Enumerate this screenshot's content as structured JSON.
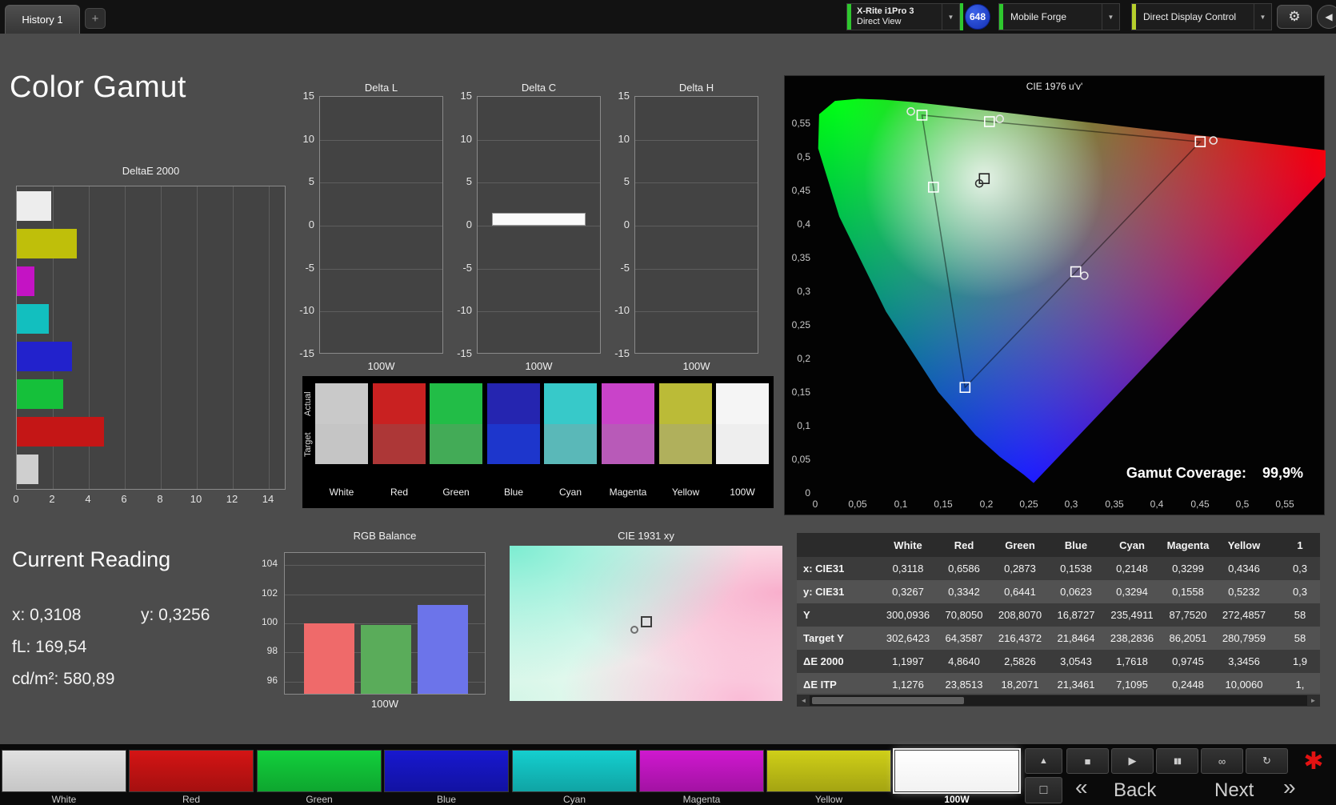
{
  "colors": {
    "meter_accent": "#2ec82e",
    "source_accent": "#2ec82e",
    "display_accent": "#b7cf2c",
    "separator_accent": "#2ec82e"
  },
  "icons": {
    "dropdown": "▼",
    "settings": "⚙",
    "collapse": "◀",
    "scroll_left": "◄",
    "scroll_right": "►",
    "expand": "▲",
    "frame": "□",
    "alert": "✱"
  },
  "top_bar": {
    "history_tab": "History 1",
    "add_tab": "+",
    "meter": {
      "name": "X-Rite i1Pro 3",
      "mode": "Direct View"
    },
    "badge_count": "648",
    "source_device": "Mobile Forge",
    "display_control": "Direct Display Control"
  },
  "page_title": "Color Gamut",
  "deltae_chart": {
    "type": "bar",
    "title": "DeltaE 2000",
    "x_ticks": [
      0,
      2,
      4,
      6,
      8,
      10,
      12,
      14
    ],
    "x_max": 14,
    "bars": [
      {
        "name": "100W",
        "value": 1.9,
        "color": "#ededed"
      },
      {
        "name": "Yellow",
        "value": 3.35,
        "color": "#bfbf0a"
      },
      {
        "name": "Magenta",
        "value": 0.97,
        "color": "#c413c4"
      },
      {
        "name": "Cyan",
        "value": 1.76,
        "color": "#12bfbf"
      },
      {
        "name": "Blue",
        "value": 3.05,
        "color": "#2222cc"
      },
      {
        "name": "Green",
        "value": 2.58,
        "color": "#15c03a"
      },
      {
        "name": "Red",
        "value": 4.86,
        "color": "#c41616"
      },
      {
        "name": "White",
        "value": 1.2,
        "color": "#cfcfcf"
      }
    ]
  },
  "delta_charts": {
    "type": "bar",
    "y_ticks": [
      15,
      10,
      5,
      0,
      -5,
      -10,
      -15
    ],
    "y_max": 15,
    "x_label": "100W",
    "charts": [
      {
        "title": "Delta L",
        "value": 0
      },
      {
        "title": "Delta C",
        "value": 1.5
      },
      {
        "title": "Delta H",
        "value": 0
      }
    ]
  },
  "swatch_compare": {
    "row_labels": [
      "Actual",
      "Target"
    ],
    "columns": [
      {
        "label": "White",
        "actual": "#c9c9c9",
        "target": "#c5c5c5"
      },
      {
        "label": "Red",
        "actual": "#c92121",
        "target": "#ad3737"
      },
      {
        "label": "Green",
        "actual": "#22bd47",
        "target": "#43ab57"
      },
      {
        "label": "Blue",
        "actual": "#2525b0",
        "target": "#1d36cc"
      },
      {
        "label": "Cyan",
        "actual": "#37c9c9",
        "target": "#5ab8b8"
      },
      {
        "label": "Magenta",
        "actual": "#c943c9",
        "target": "#b85ab8"
      },
      {
        "label": "Yellow",
        "actual": "#bbbb37",
        "target": "#b0b05c"
      },
      {
        "label": "100W",
        "actual": "#f5f5f5",
        "target": "#eeeeee"
      }
    ]
  },
  "cie1976": {
    "title": "CIE 1976 u'v'",
    "x_ticks": [
      "0",
      "0,05",
      "0,1",
      "0,15",
      "0,2",
      "0,25",
      "0,3",
      "0,35",
      "0,4",
      "0,45",
      "0,5",
      "0,55"
    ],
    "y_ticks": [
      "0",
      "0,05",
      "0,1",
      "0,15",
      "0,2",
      "0,25",
      "0,3",
      "0,35",
      "0,4",
      "0,45",
      "0,5",
      "0,55"
    ],
    "gamut_coverage_label": "Gamut Coverage:",
    "gamut_coverage_value": "99,9%",
    "markers": [
      {
        "name": "green-primary",
        "u": 0.125,
        "v": 0.5625,
        "type": "square",
        "color": "#ffffff"
      },
      {
        "name": "yellow-secondary",
        "u": 0.2039,
        "v": 0.5529,
        "type": "square",
        "color": "#ffffff"
      },
      {
        "name": "red-primary",
        "u": 0.4507,
        "v": 0.5229,
        "type": "square",
        "color": "#ffffff"
      },
      {
        "name": "white-point",
        "u": 0.1978,
        "v": 0.4683,
        "type": "square",
        "color": "#222222"
      },
      {
        "name": "cyan-secondary",
        "u": 0.1384,
        "v": 0.4555,
        "type": "square",
        "color": "#ffffff"
      },
      {
        "name": "magenta-secondary",
        "u": 0.305,
        "v": 0.33,
        "type": "square",
        "color": "#ffffff"
      },
      {
        "name": "blue-primary",
        "u": 0.1754,
        "v": 0.1579,
        "type": "square",
        "color": "#ffffff"
      },
      {
        "name": "green-target",
        "u": 0.112,
        "v": 0.568,
        "type": "circle",
        "color": "#e8e8e8"
      },
      {
        "name": "yellow-target",
        "u": 0.216,
        "v": 0.557,
        "type": "circle",
        "color": "#e8e8e8"
      },
      {
        "name": "red-target",
        "u": 0.466,
        "v": 0.525,
        "type": "circle",
        "color": "#e8e8e8"
      },
      {
        "name": "magenta-target",
        "u": 0.315,
        "v": 0.324,
        "type": "circle",
        "color": "#e8e8e8"
      },
      {
        "name": "white-target",
        "u": 0.192,
        "v": 0.461,
        "type": "circle",
        "color": "#333333"
      }
    ]
  },
  "current_reading": {
    "title": "Current Reading",
    "x": "x: 0,3108",
    "y": "y: 0,3256",
    "fl": "fL: 169,54",
    "cdm2": "cd/m²: 580,89"
  },
  "rgb_balance": {
    "type": "bar",
    "title": "RGB Balance",
    "y_ticks": [
      104,
      102,
      100,
      98,
      96
    ],
    "x_label": "100W",
    "bars": [
      {
        "name": "red",
        "value": 100.0,
        "color": "#ef6a6a"
      },
      {
        "name": "green",
        "value": 99.9,
        "color": "#5aac5a"
      },
      {
        "name": "blue",
        "value": 101.3,
        "color": "#6c74ea"
      }
    ]
  },
  "cie1931": {
    "title": "CIE 1931 xy",
    "marker": {
      "x_pct": 50,
      "y_pct": 49
    }
  },
  "results_table": {
    "columns": [
      "White",
      "Red",
      "Green",
      "Blue",
      "Cyan",
      "Magenta",
      "Yellow",
      "1"
    ],
    "rows": [
      {
        "label": "x: CIE31",
        "values": [
          "0,3118",
          "0,6586",
          "0,2873",
          "0,1538",
          "0,2148",
          "0,3299",
          "0,4346",
          "0,3"
        ]
      },
      {
        "label": "y: CIE31",
        "values": [
          "0,3267",
          "0,3342",
          "0,6441",
          "0,0623",
          "0,3294",
          "0,1558",
          "0,5232",
          "0,3"
        ]
      },
      {
        "label": "Y",
        "values": [
          "300,0936",
          "70,8050",
          "208,8070",
          "16,8727",
          "235,4911",
          "87,7520",
          "272,4857",
          "58"
        ]
      },
      {
        "label": "Target Y",
        "values": [
          "302,6423",
          "64,3587",
          "216,4372",
          "21,8464",
          "238,2836",
          "86,2051",
          "280,7959",
          "58"
        ]
      },
      {
        "label": "ΔE 2000",
        "values": [
          "1,1997",
          "4,8640",
          "2,5826",
          "3,0543",
          "1,7618",
          "0,9745",
          "3,3456",
          "1,9"
        ]
      },
      {
        "label": "ΔE ITP",
        "values": [
          "1,1276",
          "23,8513",
          "18,2071",
          "21,3461",
          "7,1095",
          "0,2448",
          "10,0060",
          "1,"
        ]
      }
    ]
  },
  "bottom_bar": {
    "swatches": [
      {
        "label": "White",
        "color_top": "#e0e0e0",
        "color_bottom": "#c6c6c6",
        "selected": false
      },
      {
        "label": "Red",
        "color_top": "#d41414",
        "color_bottom": "#a51010",
        "selected": false
      },
      {
        "label": "Green",
        "color_top": "#12cf3c",
        "color_bottom": "#0ea62f",
        "selected": false
      },
      {
        "label": "Blue",
        "color_top": "#1818cf",
        "color_bottom": "#1212a2",
        "selected": false
      },
      {
        "label": "Cyan",
        "color_top": "#14cfcf",
        "color_bottom": "#10a4a4",
        "selected": false
      },
      {
        "label": "Magenta",
        "color_top": "#cf18cf",
        "color_bottom": "#a312a3",
        "selected": false
      },
      {
        "label": "Yellow",
        "color_top": "#cfcf18",
        "color_bottom": "#a4a412",
        "selected": false
      },
      {
        "label": "100W",
        "color_top": "#ffffff",
        "color_bottom": "#f2f2f2",
        "selected": true
      }
    ],
    "transport": [
      {
        "name": "stop",
        "glyph": "■"
      },
      {
        "name": "play",
        "glyph": "▶"
      },
      {
        "name": "pause",
        "glyph": "▮▮"
      },
      {
        "name": "continuous",
        "glyph": "∞"
      },
      {
        "name": "refresh",
        "glyph": "↻"
      }
    ],
    "back_chevrons": "«",
    "back_label": "Back",
    "next_label": "Next",
    "next_chevrons": "»"
  }
}
